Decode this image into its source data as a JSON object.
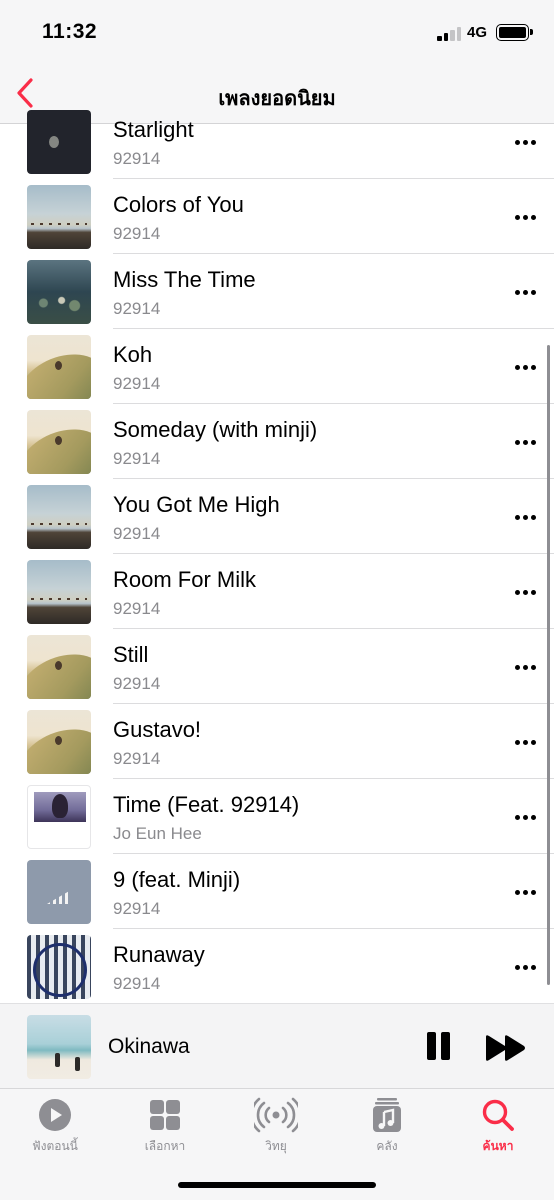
{
  "status_bar": {
    "time": "11:32",
    "network": "4G"
  },
  "nav": {
    "title": "เพลงยอดนิยม",
    "back_icon": "chevron-left-icon",
    "accent_color": "#fa2d48"
  },
  "tracks": [
    {
      "title": "Starlight",
      "artist": "92914",
      "art": "dark"
    },
    {
      "title": "Colors of You",
      "artist": "92914",
      "art": "sky"
    },
    {
      "title": "Miss The Time",
      "artist": "92914",
      "art": "night"
    },
    {
      "title": "Koh",
      "artist": "92914",
      "art": "hill"
    },
    {
      "title": "Someday (with minji)",
      "artist": "92914",
      "art": "hill"
    },
    {
      "title": "You Got Me High",
      "artist": "92914",
      "art": "sky"
    },
    {
      "title": "Room For Milk",
      "artist": "92914",
      "art": "sky"
    },
    {
      "title": "Still",
      "artist": "92914",
      "art": "hill"
    },
    {
      "title": "Gustavo!",
      "artist": "92914",
      "art": "hill"
    },
    {
      "title": "Time (Feat. 92914)",
      "artist": "Jo Eun Hee",
      "art": "purple"
    },
    {
      "title": "9 (feat. Minji)",
      "artist": "92914",
      "art": "grey"
    },
    {
      "title": "Runaway",
      "artist": "92914",
      "art": "pattern"
    }
  ],
  "now_playing": {
    "title": "Okinawa",
    "pause_icon": "pause-icon",
    "forward_icon": "fast-forward-icon"
  },
  "tabs": [
    {
      "label": "ฟังตอนนี้",
      "icon": "play-circle-icon",
      "active": false
    },
    {
      "label": "เลือกหา",
      "icon": "grid-icon",
      "active": false
    },
    {
      "label": "วิทยุ",
      "icon": "radio-icon",
      "active": false
    },
    {
      "label": "คลัง",
      "icon": "library-icon",
      "active": false
    },
    {
      "label": "ค้นหา",
      "icon": "search-icon",
      "active": true
    }
  ]
}
